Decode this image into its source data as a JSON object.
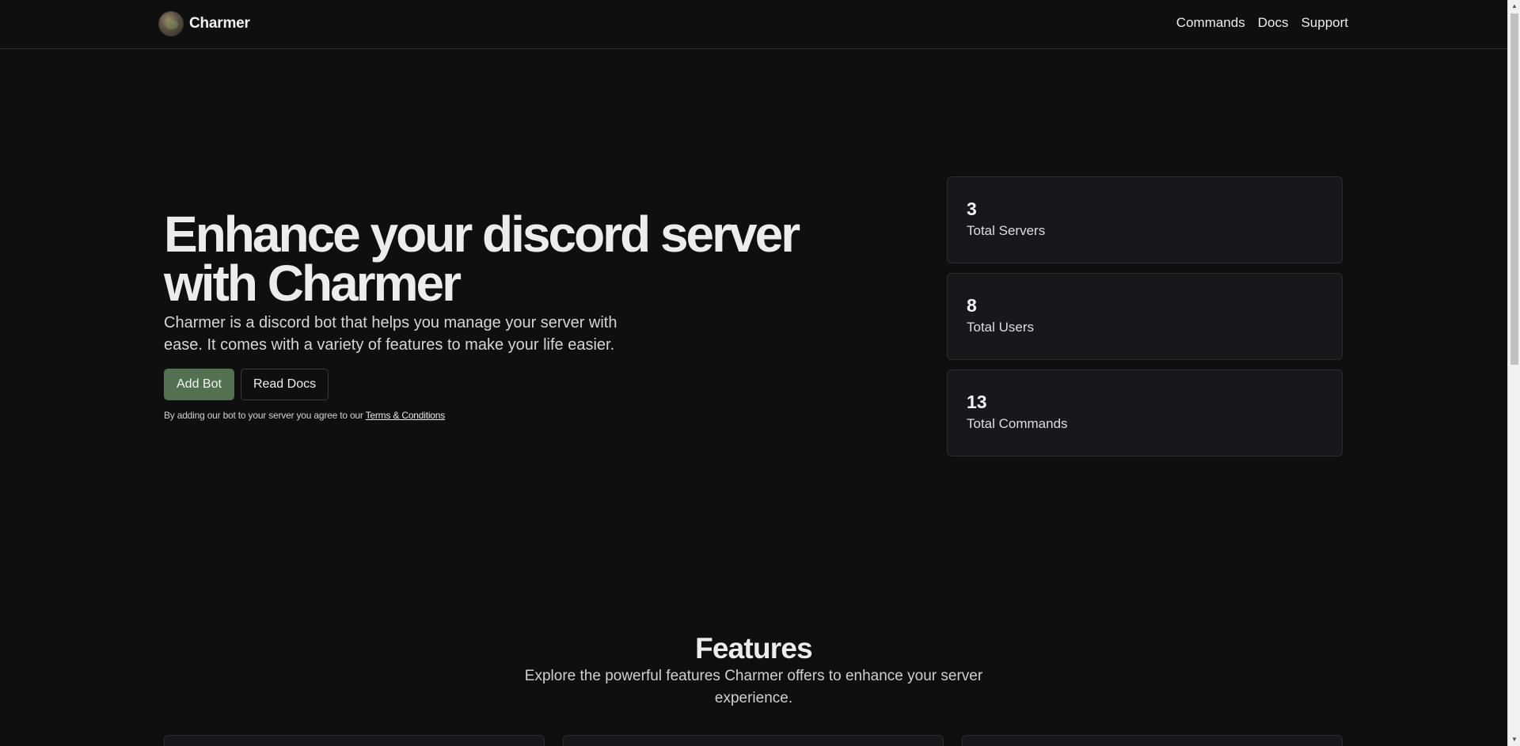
{
  "nav": {
    "brand": "Charmer",
    "links": [
      "Commands",
      "Docs",
      "Support"
    ]
  },
  "hero": {
    "title": "Enhance your discord server with Charmer",
    "description": "Charmer is a discord bot that helps you manage your server with ease. It comes with a variety of features to make your life easier.",
    "add_bot_label": "Add Bot",
    "read_docs_label": "Read Docs",
    "terms_prefix": "By adding our bot to your server you agree to our ",
    "terms_link": "Terms & Conditions"
  },
  "stats": [
    {
      "value": "3",
      "label": "Total Servers"
    },
    {
      "value": "8",
      "label": "Total Users"
    },
    {
      "value": "13",
      "label": "Total Commands"
    }
  ],
  "features": {
    "title": "Features",
    "subtitle": "Explore the powerful features Charmer offers to enhance your server experience."
  },
  "colors": {
    "background": "#0f0f10",
    "accent": "#537050",
    "card": "#18181a"
  },
  "icons": {
    "avatar": "charmer-avatar",
    "scroll_up": "scroll-up-arrow",
    "scroll_down": "scroll-down-arrow"
  }
}
